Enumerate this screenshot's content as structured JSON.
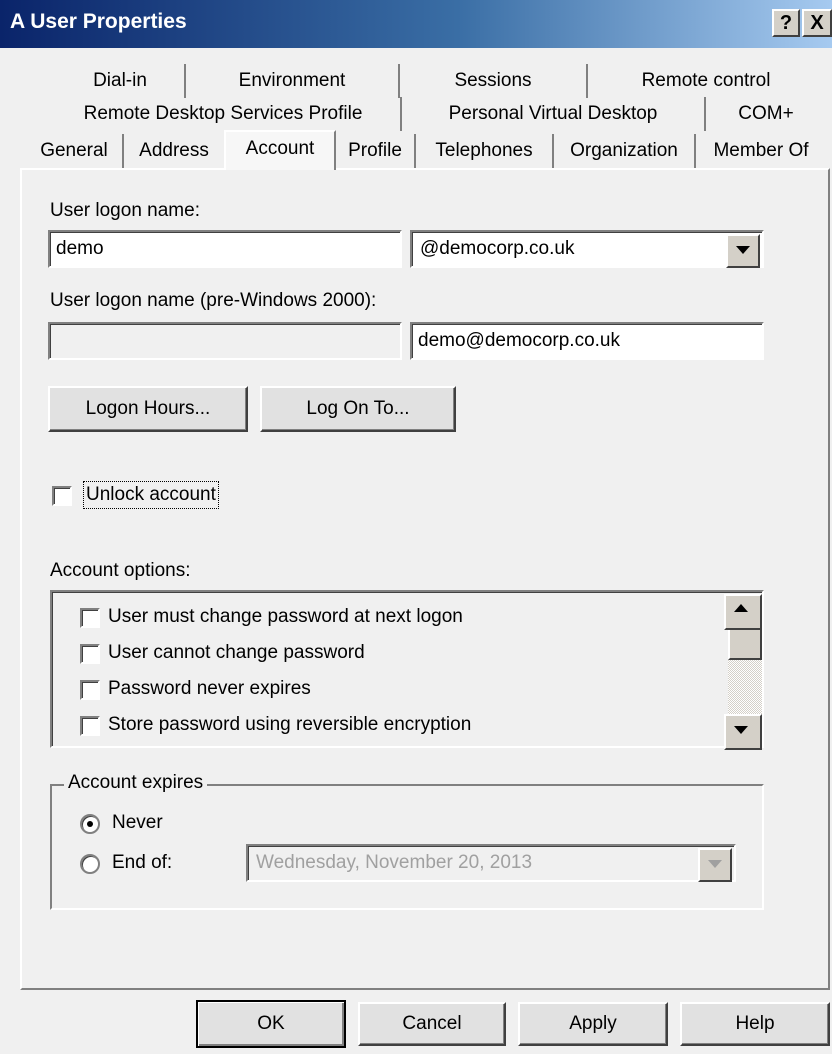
{
  "window": {
    "title": "A User Properties",
    "help_glyph": "?",
    "close_glyph": "X"
  },
  "tabs": {
    "row1": [
      "Dial-in",
      "Environment",
      "Sessions",
      "Remote control"
    ],
    "row2": [
      "Remote Desktop Services Profile",
      "Personal Virtual Desktop",
      "COM+"
    ],
    "row3": [
      "General",
      "Address",
      "Account",
      "Profile",
      "Telephones",
      "Organization",
      "Member Of"
    ],
    "active": "Account"
  },
  "account": {
    "logon_name_label": "User logon name:",
    "logon_name_value": "demo",
    "domain_suffix_value": "@democorp.co.uk",
    "pre2000_label": "User logon name (pre-Windows 2000):",
    "pre2000_domain_value": "",
    "pre2000_name_value": "demo@democorp.co.uk",
    "logon_hours_button": "Logon Hours...",
    "logon_to_button": "Log On To...",
    "unlock_label": "Unlock account",
    "options_label": "Account options:",
    "options": [
      "User must change password at next logon",
      "User cannot change password",
      "Password never expires",
      "Store password using reversible encryption"
    ],
    "expires_group_title": "Account expires",
    "never_label": "Never",
    "end_of_label": "End of:",
    "end_of_date_value": "Wednesday, November 20, 2013"
  },
  "footer": {
    "ok": "OK",
    "cancel": "Cancel",
    "apply": "Apply",
    "help": "Help"
  },
  "colors": {
    "titlebar_start": "#0a246a",
    "titlebar_end": "#a6caf0",
    "dialog_bg": "#f0f0f0"
  }
}
